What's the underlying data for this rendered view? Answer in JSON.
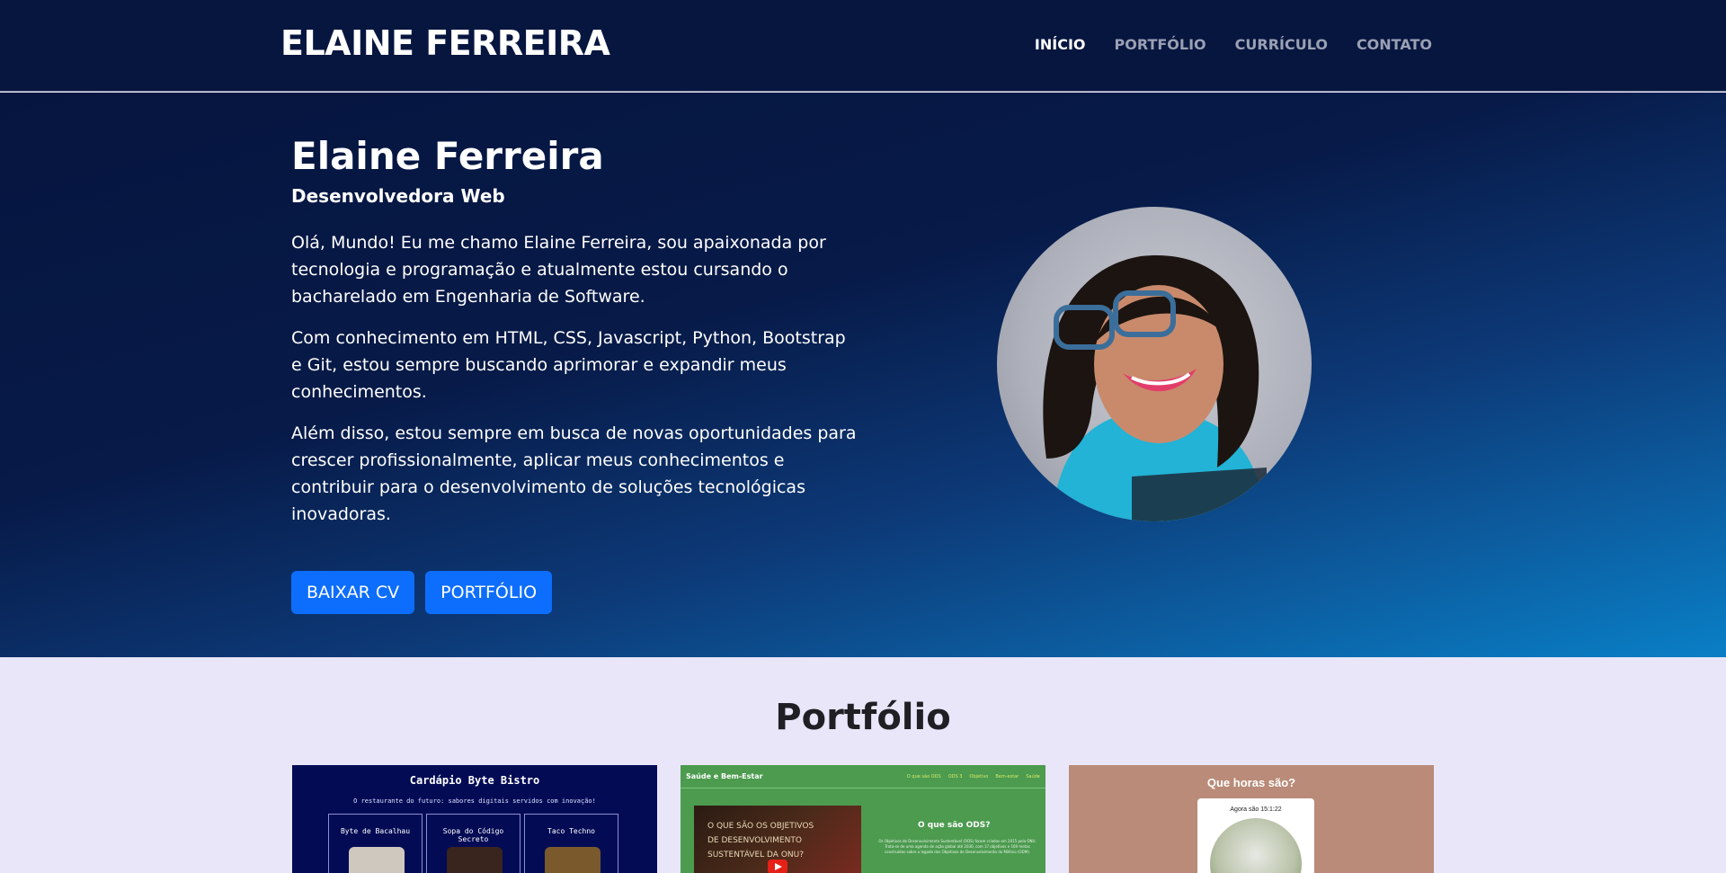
{
  "nav": {
    "brand": "ELAINE FERREIRA",
    "links": [
      {
        "label": "INÍCIO",
        "active": true
      },
      {
        "label": "PORTFÓLIO",
        "active": false
      },
      {
        "label": "CURRÍCULO",
        "active": false
      },
      {
        "label": "CONTATO",
        "active": false
      }
    ]
  },
  "hero": {
    "name": "Elaine Ferreira",
    "role": "Desenvolvedora Web",
    "paragraphs": [
      "Olá, Mundo! Eu me chamo Elaine Ferreira, sou apaixonada por tecnologia e programação e atualmente estou cursando o bacharelado em Engenharia de Software.",
      "Com conhecimento em HTML, CSS, Javascript, Python, Bootstrap e Git, estou sempre buscando aprimorar e expandir meus conhecimentos.",
      "Além disso, estou sempre em busca de novas oportunidades para crescer profissionalmente, aplicar meus conhecimentos e contribuir para o desenvolvimento de soluções tecnológicas inovadoras."
    ],
    "buttons": {
      "download_cv": "BAIXAR CV",
      "portfolio": "PORTFÓLIO"
    }
  },
  "portfolio": {
    "title": "Portfólio",
    "card1": {
      "title": "Cardápio Byte Bistro",
      "subtitle": "O restaurante do futuro: sabores digitais servidos com inovação!",
      "items": [
        "Byte de Bacalhau",
        "Sopa do Código Secreto",
        "Taco Techno"
      ]
    },
    "card2": {
      "brand": "Saúde e Bem-Estar",
      "links": [
        "O que são ODS",
        "ODS 3",
        "Objetivo",
        "Bem-estar",
        "Saúde"
      ],
      "video_text": "O QUE SÃO OS OBJETIVOS DE DESENVOLVIMENTO SUSTENTÁVEL DA ONU?",
      "heading": "O que são ODS?",
      "paragraph": "Os Objetivos de Desenvolvimento Sustentável (ODS) foram criados em 2015 pela ONU. Trata-se de uma agenda de ação global até 2030, com 17 objetivos e 169 metas construídas sobre o legado dos Objetivos de Desenvolvimento do Milênio (ODM)."
    },
    "card3": {
      "title": "Que horas são?",
      "time": "Agora são 15:1:22"
    }
  },
  "colors": {
    "nav_bg": "#07163f",
    "hero_gradient_start": "#06153f",
    "hero_gradient_end": "#0a7fc6",
    "button": "#0d6efd",
    "portfolio_bg": "#e9e6fa"
  }
}
